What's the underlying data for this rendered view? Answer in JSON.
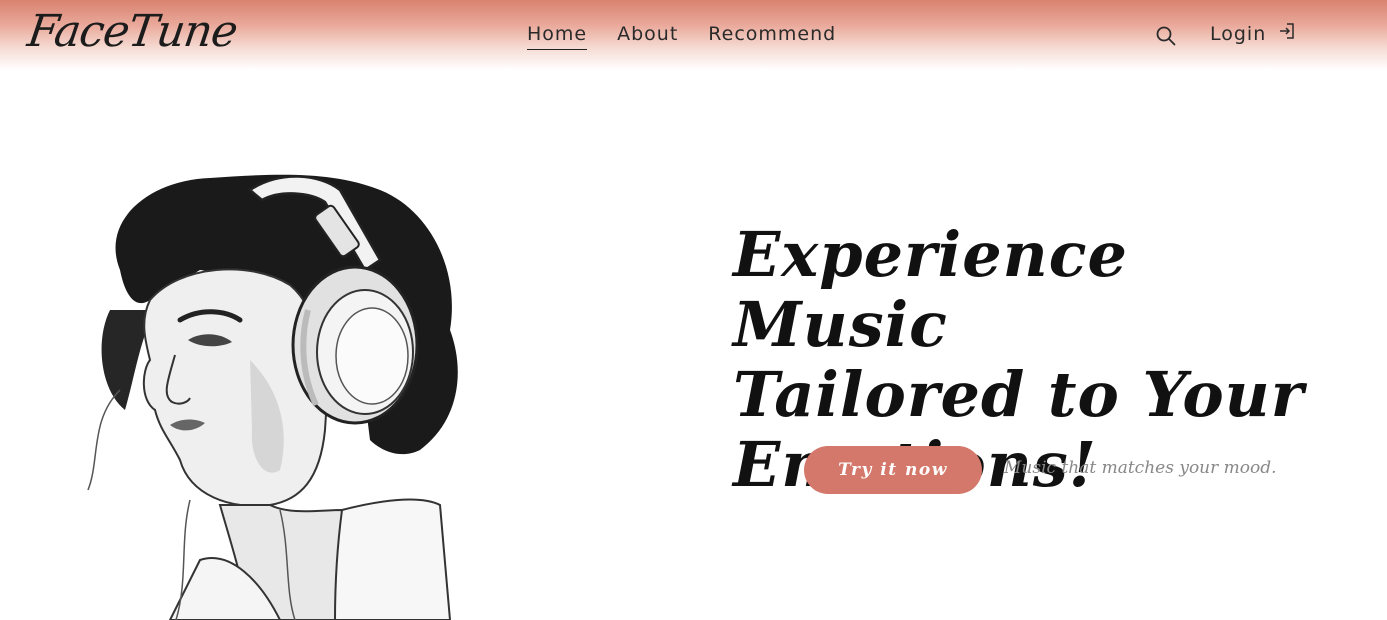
{
  "brand": {
    "logo_text": "FaceTune"
  },
  "nav": {
    "items": [
      {
        "label": "Home",
        "active": true
      },
      {
        "label": "About",
        "active": false
      },
      {
        "label": "Recommend",
        "active": false
      }
    ]
  },
  "header_actions": {
    "search_icon": "search-icon",
    "login_label": "Login",
    "login_icon": "login-icon"
  },
  "hero": {
    "headline_line1": "Experience Music",
    "headline_line2": "Tailored to Your",
    "headline_line3": "Emotions!",
    "cta_label": "Try it now",
    "tagline": "Music that matches your mood."
  },
  "colors": {
    "header_gradient_top": "#d98270",
    "accent": "#d3786a",
    "text": "#111111",
    "tagline": "#888888"
  }
}
